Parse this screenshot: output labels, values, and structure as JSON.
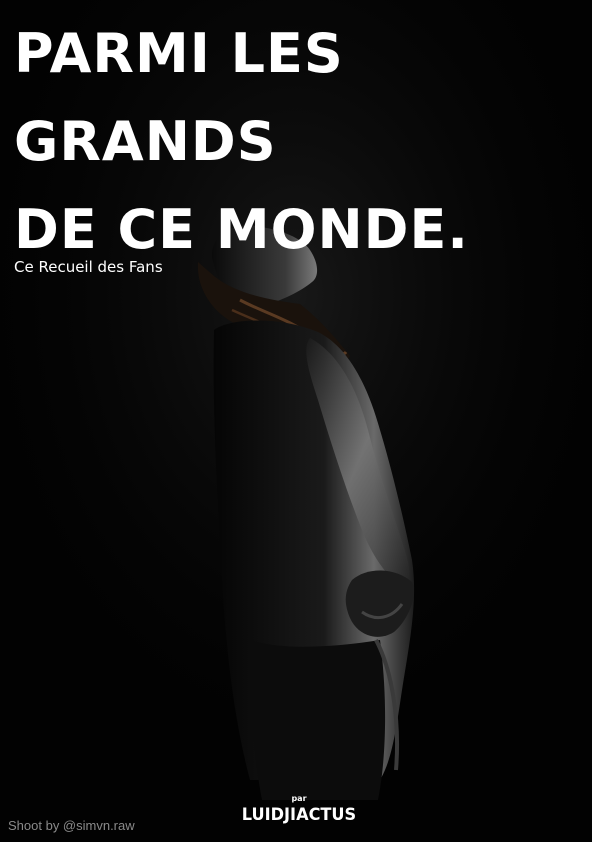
{
  "cover": {
    "title_lines": [
      "PARMI LES",
      "GRANDS",
      "DE CE MONDE."
    ],
    "subtitle": "Ce Recueil des Fans",
    "photo_credit": "Shoot by @simvn.raw",
    "brand_prefix": "par",
    "brand_name": "LUIDJIACTUS"
  },
  "colors": {
    "background": "#020202",
    "text": "#ffffff",
    "credit_text": "#8a8a8a"
  }
}
